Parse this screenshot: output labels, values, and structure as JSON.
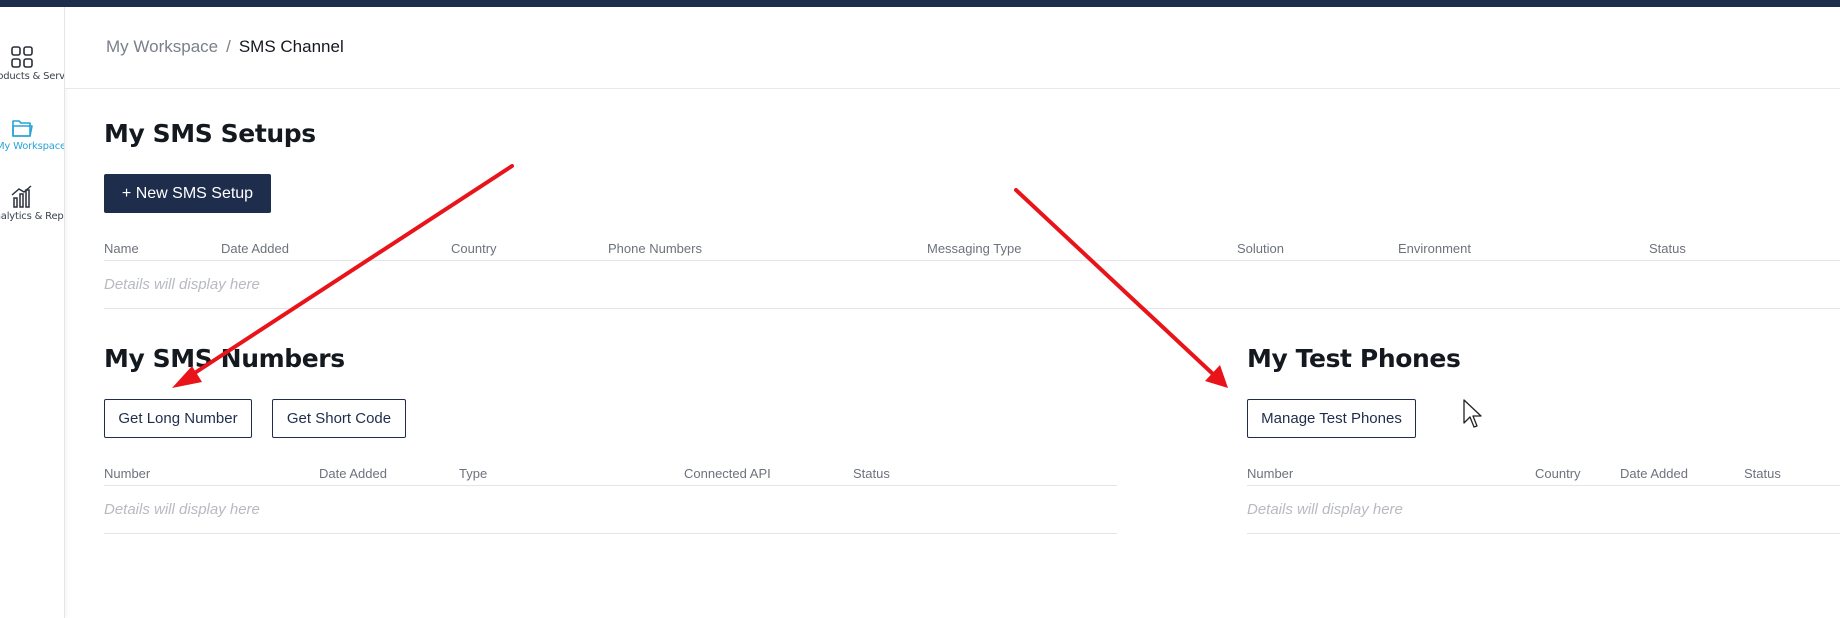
{
  "sidebar": {
    "items": [
      {
        "label": "Products & Services",
        "icon": "grid-icon",
        "active": false
      },
      {
        "label": "My Workspace",
        "icon": "folder-icon",
        "active": true
      },
      {
        "label": "Analytics & Reports",
        "icon": "bar-chart-icon",
        "active": false
      }
    ]
  },
  "breadcrumb": {
    "parent": "My Workspace",
    "separator": "/",
    "current": "SMS Channel"
  },
  "sms_setups": {
    "title": "My SMS Setups",
    "new_button": "+ New SMS Setup",
    "columns": [
      "Name",
      "Date Added",
      "Country",
      "Phone Numbers",
      "Messaging Type",
      "Solution",
      "Environment",
      "Status"
    ],
    "empty_text": "Details will display here"
  },
  "sms_numbers": {
    "title": "My SMS Numbers",
    "long_button": "Get Long Number",
    "short_button": "Get Short Code",
    "columns": [
      "Number",
      "Date Added",
      "Type",
      "Connected API",
      "Status"
    ],
    "empty_text": "Details will display here"
  },
  "test_phones": {
    "title": "My Test Phones",
    "manage_button": "Manage Test Phones",
    "columns": [
      "Number",
      "Country",
      "Date Added",
      "Status"
    ],
    "empty_text": "Details will display here"
  },
  "colors": {
    "navy": "#1f2d4d",
    "accent": "#2aa3d8",
    "annotation_arrow": "#e8141a"
  }
}
